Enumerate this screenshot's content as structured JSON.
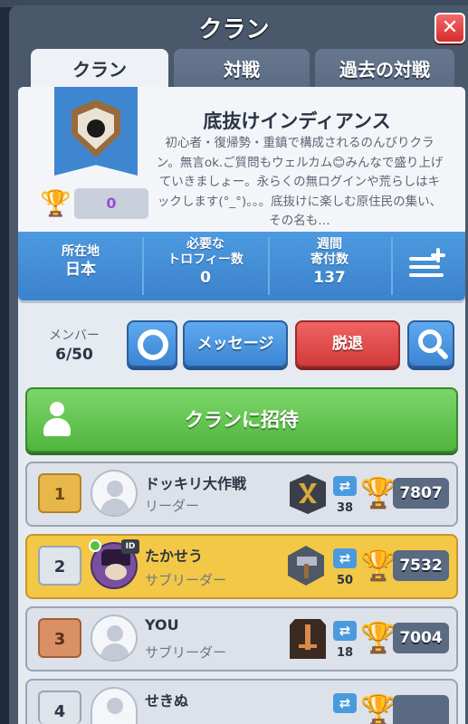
{
  "header": {
    "title": "クラン",
    "close_label": "✕"
  },
  "tabs": [
    {
      "label": "クラン",
      "active": true
    },
    {
      "label": "対戦",
      "active": false
    },
    {
      "label": "過去の対戦",
      "active": false
    }
  ],
  "clan": {
    "name": "底抜けインディアンス",
    "description": "初心者・復帰勢・重鎮で構成されるのんびりクラン。無言ok.ご質問もウェルカム😊みんなで盛り上げていきましょー。永らくの無ログインや荒らしはキックします(°_°)。。。底抜けに楽しむ原住民の集い、その名も…",
    "trophy_value": "0",
    "trophy_icon": "trophy-icon",
    "badge_icon": "bomb-badge-icon"
  },
  "stats": {
    "location_label": "所在地",
    "location_value": "日本",
    "required_label_1": "必要な",
    "required_label_2": "トロフィー数",
    "required_value": "0",
    "donations_label_1": "週間",
    "donations_label_2": "寄付数",
    "donations_value": "137"
  },
  "members_header": {
    "label": "メンバー",
    "count": "6/50"
  },
  "buttons": {
    "message": "メッセージ",
    "leave": "脱退",
    "invite": "クランに招待"
  },
  "members": [
    {
      "rank": "1",
      "name": "ドッキリ大作戦",
      "role": "リーダー",
      "donations": "38",
      "trophies": "7807",
      "highlight": false
    },
    {
      "rank": "2",
      "name": "たかせう",
      "role": "サブリーダー",
      "donations": "50",
      "trophies": "7532",
      "highlight": true,
      "online": true,
      "id_tag": "ID"
    },
    {
      "rank": "3",
      "name": "YOU",
      "role": "サブリーダー",
      "donations": "18",
      "trophies": "7004",
      "highlight": false
    },
    {
      "rank": "4",
      "name": "せきぬ",
      "role": "",
      "donations": "",
      "trophies": "",
      "highlight": false
    }
  ],
  "colors": {
    "accent_blue": "#3b84d2",
    "leave_red": "#d23a3a",
    "invite_green": "#50b53e",
    "highlight_gold": "#f2c846"
  }
}
